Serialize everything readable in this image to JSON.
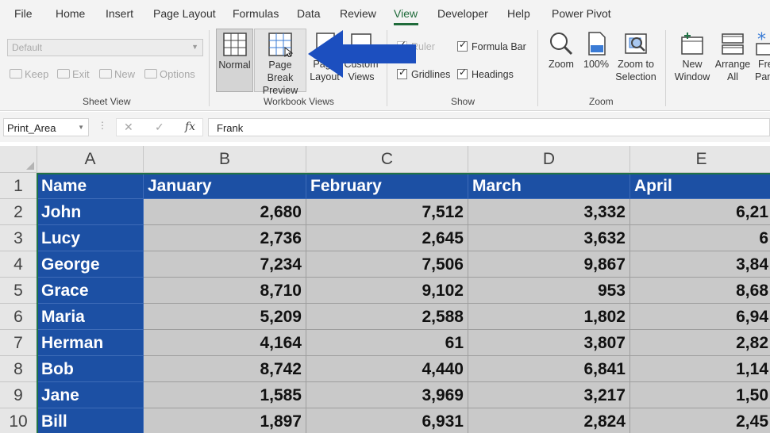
{
  "ribbon_tabs": [
    "File",
    "Home",
    "Insert",
    "Page Layout",
    "Formulas",
    "Data",
    "Review",
    "View",
    "Developer",
    "Help",
    "Power Pivot"
  ],
  "active_tab": "View",
  "sheet_view": {
    "dropdown_value": "Default",
    "keep": "Keep",
    "exit": "Exit",
    "new": "New",
    "options": "Options",
    "group_label": "Sheet View"
  },
  "workbook_views": {
    "normal": "Normal",
    "page_break_1": "Page Break",
    "page_break_2": "Preview",
    "page_layout_1": "Page",
    "page_layout_2": "Layout",
    "custom_views_1": "Custom",
    "custom_views_2": "Views",
    "group_label": "Workbook Views"
  },
  "show": {
    "ruler": "Ruler",
    "formula_bar": "Formula Bar",
    "gridlines": "Gridlines",
    "headings": "Headings",
    "group_label": "Show"
  },
  "zoom": {
    "zoom": "Zoom",
    "hundred": "100%",
    "zoom_to_1": "Zoom to",
    "zoom_to_2": "Selection",
    "group_label": "Zoom"
  },
  "window": {
    "new_window_1": "New",
    "new_window_2": "Window",
    "arrange_1": "Arrange",
    "arrange_2": "All",
    "freeze_1": "Free",
    "freeze_2": "Pan"
  },
  "formula_bar": {
    "name_box": "Print_Area",
    "dots": "⋮",
    "cancel": "✕",
    "enter": "✓",
    "fx": "fx",
    "content": "Frank"
  },
  "columns": [
    "A",
    "B",
    "C",
    "D",
    "E"
  ],
  "rows": [
    "1",
    "2",
    "3",
    "4",
    "5",
    "6",
    "7",
    "8",
    "9",
    "10"
  ],
  "table": {
    "headers": [
      "Name",
      "January",
      "February",
      "March",
      "April"
    ],
    "data": [
      [
        "John",
        "2,680",
        "7,512",
        "3,332",
        "6,21"
      ],
      [
        "Lucy",
        "2,736",
        "2,645",
        "3,632",
        "6"
      ],
      [
        "George",
        "7,234",
        "7,506",
        "9,867",
        "3,84"
      ],
      [
        "Grace",
        "8,710",
        "9,102",
        "953",
        "8,68"
      ],
      [
        "Maria",
        "5,209",
        "2,588",
        "1,802",
        "6,94"
      ],
      [
        "Herman",
        "4,164",
        "61",
        "3,807",
        "2,82"
      ],
      [
        "Bob",
        "8,742",
        "4,440",
        "6,841",
        "1,14"
      ],
      [
        "Jane",
        "1,585",
        "3,969",
        "3,217",
        "1,50"
      ],
      [
        "Bill",
        "1,897",
        "6,931",
        "2,824",
        "2,45"
      ]
    ]
  },
  "colors": {
    "accent_green": "#217346",
    "selection_blue": "#1c50a4",
    "arrow_blue": "#1c4fbf"
  }
}
